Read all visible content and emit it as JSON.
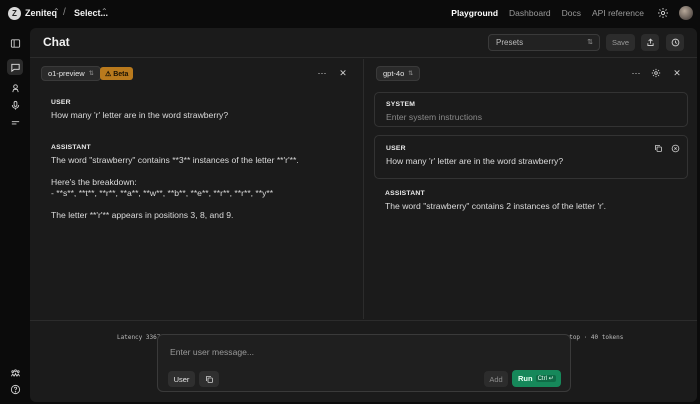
{
  "nav": {
    "org_initial": "Z",
    "org_name": "Zeniteq",
    "crumb_separator": "/",
    "project_name": "Select...",
    "links": [
      "Playground",
      "Dashboard",
      "Docs",
      "API reference"
    ],
    "active_link": "Playground"
  },
  "header": {
    "title": "Chat",
    "presets_label": "Presets",
    "save_label": "Save"
  },
  "left_panel": {
    "model": "o1-preview",
    "badge": "⚠ Beta",
    "messages": [
      {
        "role": "USER",
        "text": "How many 'r' letter are in the word strawberry?"
      },
      {
        "role": "ASSISTANT",
        "lines": [
          "The word \"strawberry\" contains **3** instances of the letter **'r'**.",
          "",
          "Here's the breakdown:",
          "- **s**, **t**, **r**, **a**, **w**, **b**, **e**, **r**, **r**, **y**",
          "",
          "The letter **'r'** appears in positions 3, 8, and 9."
        ]
      }
    ],
    "latency": "Latency 33670ms · Finish reason: stop · 298 tokens"
  },
  "right_panel": {
    "model": "gpt-4o",
    "system_role": "SYSTEM",
    "system_placeholder": "Enter system instructions",
    "user_role": "USER",
    "user_text": "How many 'r' letter are in the word strawberry?",
    "assistant_role": "ASSISTANT",
    "assistant_text": "The word \"strawberry\" contains 2 instances of the letter 'r'.",
    "latency": "Latency 1049ms · Finish reason: stop · 40 tokens"
  },
  "composer": {
    "placeholder": "Enter user message...",
    "role_chip": "User",
    "add_label": "Add",
    "run_label": "Run",
    "run_shortcut": "Ctrl ↵"
  },
  "colors": {
    "background": "#0b0b0b",
    "surface": "#1b1b1b",
    "beta_badge": "#b97a1d",
    "run_button": "#16885a"
  },
  "icons": [
    "sidebar-toggle-icon",
    "chat-icon",
    "assistants-icon",
    "microphone-icon",
    "completions-icon",
    "cookbook-icon",
    "help-icon",
    "gear-icon",
    "share-icon",
    "history-icon",
    "more-icon",
    "close-icon",
    "copy-icon",
    "remove-icon"
  ]
}
